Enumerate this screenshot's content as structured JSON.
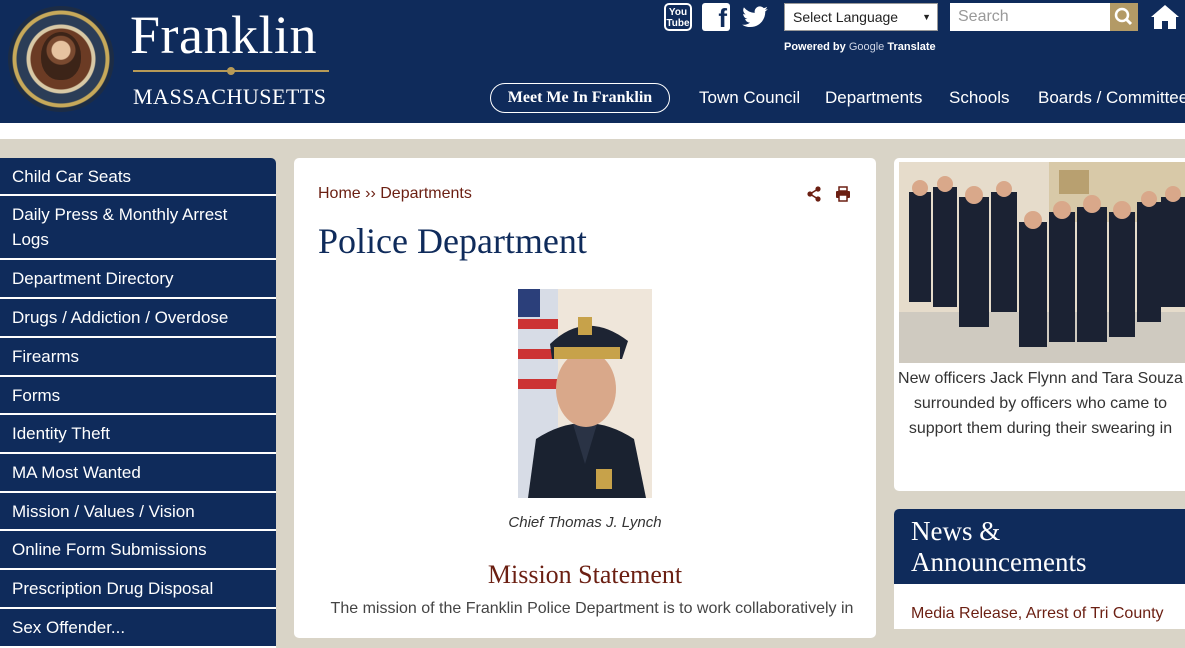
{
  "header": {
    "brand_title": "Franklin",
    "brand_subtitle": "MASSACHUSETTS",
    "seal_text_top": "FRANKLIN MASSACHUSETTS",
    "seal_text_bottom": "INDUSTRY NEED NOT WISH",
    "social": {
      "youtube_label": "You Tube",
      "facebook_label": "f"
    },
    "language_select": "Select Language",
    "powered_by": "Powered by",
    "google": "Google",
    "translate": "Translate",
    "search_placeholder": "Search",
    "nav": {
      "meet": "Meet Me In Franklin",
      "items": [
        "Town Council",
        "Departments",
        "Schools",
        "Boards / Committees"
      ]
    }
  },
  "sidebar": {
    "items": [
      "Child Car Seats",
      "Daily Press & Monthly Arrest Logs",
      "Department Directory",
      "Drugs / Addiction / Overdose",
      "Firearms",
      "Forms",
      "Identity Theft",
      "MA Most Wanted",
      "Mission / Values / Vision",
      "Online Form Submissions",
      "Prescription Drug Disposal",
      "Sex Offender..."
    ]
  },
  "main": {
    "breadcrumb": {
      "home": "Home",
      "sep": "››",
      "current": "Departments"
    },
    "title": "Police Department",
    "portrait_caption": "Chief Thomas J. Lynch",
    "mission_heading": "Mission Statement",
    "mission_text": "The mission of the Franklin Police Department is to work collaboratively in"
  },
  "right": {
    "photo_caption": "New officers Jack Flynn and Tara Souza surrounded by officers who came to support them during their swearing in",
    "news_title": "News & Announcements",
    "news_item": "Media Release, Arrest of Tri County"
  },
  "colors": {
    "navy": "#0f2b5b",
    "maroon": "#6b1f12",
    "gold": "#b79a57",
    "background": "#d9d4c7"
  }
}
